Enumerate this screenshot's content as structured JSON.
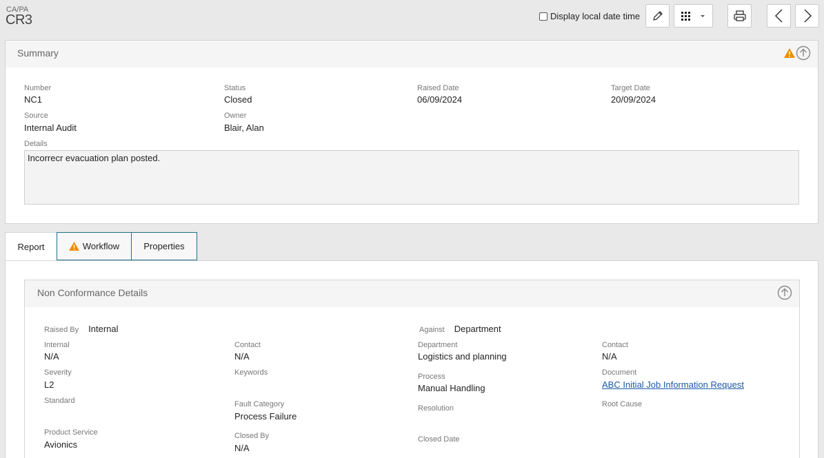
{
  "header": {
    "module": "CA/PA",
    "record": "CR3",
    "display_local_label": "Display local date time"
  },
  "summary": {
    "title": "Summary",
    "fields": {
      "number": {
        "label": "Number",
        "value": "NC1"
      },
      "status": {
        "label": "Status",
        "value": "Closed"
      },
      "raised_date": {
        "label": "Raised Date",
        "value": "06/09/2024"
      },
      "target_date": {
        "label": "Target Date",
        "value": "20/09/2024"
      },
      "source": {
        "label": "Source",
        "value": "Internal Audit"
      },
      "owner": {
        "label": "Owner",
        "value": "Blair, Alan"
      },
      "details": {
        "label": "Details",
        "value": "Incorrecr evacuation plan posted."
      }
    }
  },
  "tabs": {
    "report": "Report",
    "workflow": "Workflow",
    "properties": "Properties"
  },
  "nc": {
    "title": "Non Conformance Details",
    "raised_by": {
      "label": "Raised By",
      "value": "Internal"
    },
    "against": {
      "label": "Against",
      "value": "Department"
    },
    "internal": {
      "label": "Internal",
      "value": "N/A"
    },
    "contact1": {
      "label": "Contact",
      "value": "N/A"
    },
    "department": {
      "label": "Department",
      "value": "Logistics and planning"
    },
    "contact2": {
      "label": "Contact",
      "value": "N/A"
    },
    "severity": {
      "label": "Severity",
      "value": "L2"
    },
    "keywords": {
      "label": "Keywords",
      "value": ""
    },
    "process": {
      "label": "Process",
      "value": "Manual Handling"
    },
    "document": {
      "label": "Document",
      "value": "ABC Initial Job Information Request"
    },
    "standard": {
      "label": "Standard",
      "value": ""
    },
    "fault_category": {
      "label": "Fault Category",
      "value": "Process Failure"
    },
    "resolution": {
      "label": "Resolution",
      "value": ""
    },
    "root_cause": {
      "label": "Root Cause",
      "value": ""
    },
    "product_service": {
      "label": "Product Service",
      "value": "Avionics"
    },
    "closed_by": {
      "label": "Closed By",
      "value": "N/A"
    },
    "closed_date": {
      "label": "Closed Date",
      "value": ""
    }
  },
  "colors": {
    "warning": "#f08c00",
    "tab_border": "#1e6e8a",
    "link": "#1a5aa8"
  },
  "icons": [
    "pencil-icon",
    "grid-icon",
    "caret-down-icon",
    "printer-icon",
    "chevron-left-icon",
    "chevron-right-icon",
    "warning-icon",
    "collapse-up-icon"
  ]
}
